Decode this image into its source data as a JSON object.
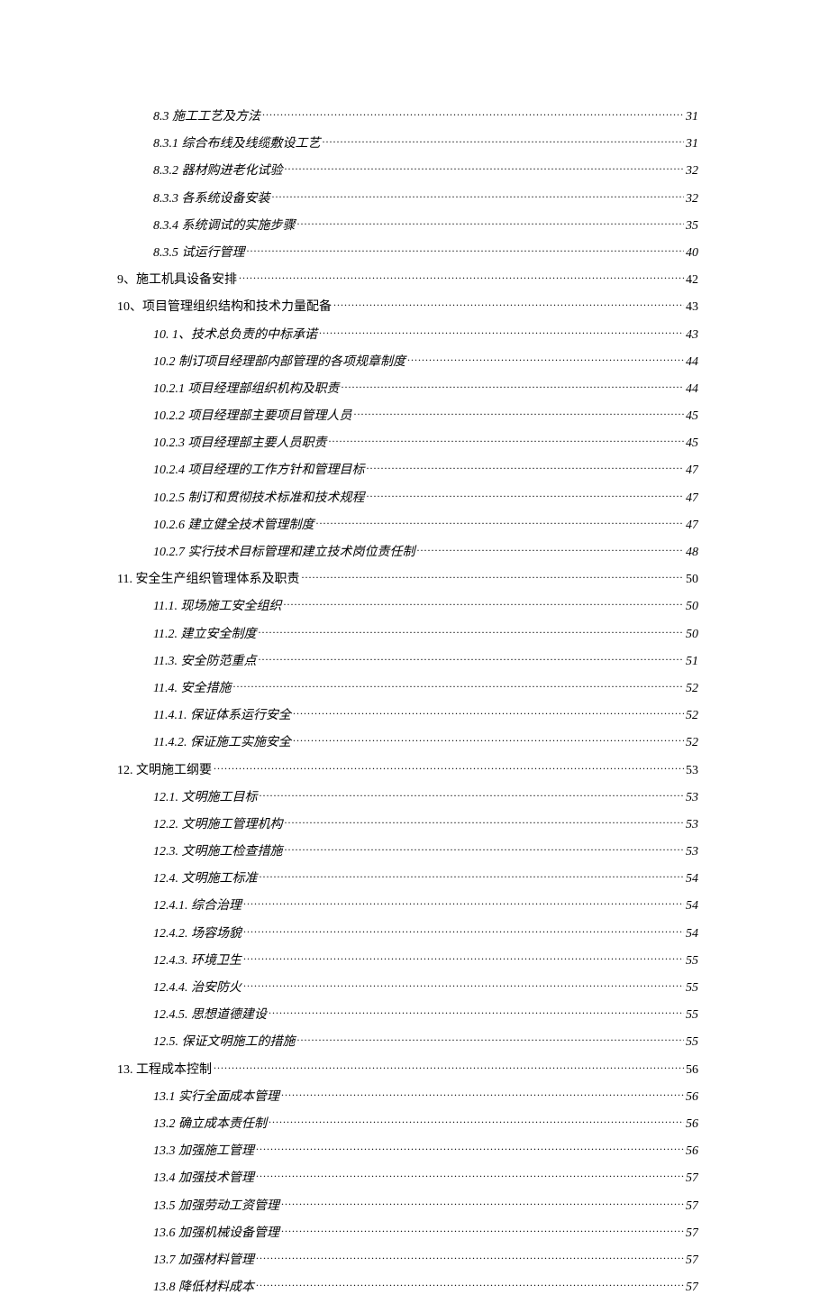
{
  "toc": [
    {
      "level": 2,
      "title": "8.3 施工工艺及方法",
      "page": "31"
    },
    {
      "level": 2,
      "title": "8.3.1 综合布线及线缆敷设工艺",
      "page": "31"
    },
    {
      "level": 2,
      "title": "8.3.2 器材购进老化试验",
      "page": "32"
    },
    {
      "level": 2,
      "title": "8.3.3 各系统设备安装",
      "page": "32"
    },
    {
      "level": 2,
      "title": "8.3.4 系统调试的实施步骤",
      "page": "35"
    },
    {
      "level": 2,
      "title": "8.3.5 试运行管理",
      "page": "40"
    },
    {
      "level": 1,
      "title": "9、施工机具设备安排",
      "page": "42"
    },
    {
      "level": 1,
      "title": "10、项目管理组织结构和技术力量配备",
      "page": "43"
    },
    {
      "level": 2,
      "title": "10. 1、技术总负责的中标承诺",
      "page": "43"
    },
    {
      "level": 2,
      "title": "10.2 制订项目经理部内部管理的各项规章制度",
      "page": "44"
    },
    {
      "level": 2,
      "title": "10.2.1 项目经理部组织机构及职责",
      "page": "44"
    },
    {
      "level": 2,
      "title": "10.2.2 项目经理部主要项目管理人员",
      "page": "45"
    },
    {
      "level": 2,
      "title": "10.2.3 项目经理部主要人员职责",
      "page": "45"
    },
    {
      "level": 2,
      "title": "10.2.4 项目经理的工作方针和管理目标",
      "page": "47"
    },
    {
      "level": 2,
      "title": "10.2.5 制订和贯彻技术标准和技术规程",
      "page": "47"
    },
    {
      "level": 2,
      "title": "10.2.6 建立健全技术管理制度",
      "page": "47"
    },
    {
      "level": 2,
      "title": "10.2.7 实行技术目标管理和建立技术岗位责任制",
      "page": "48"
    },
    {
      "level": 1,
      "title": "11. 安全生产组织管理体系及职责",
      "page": "50"
    },
    {
      "level": 2,
      "title": "11.1. 现场施工安全组织",
      "page": "50"
    },
    {
      "level": 2,
      "title": "11.2. 建立安全制度",
      "page": "50"
    },
    {
      "level": 2,
      "title": "11.3. 安全防范重点",
      "page": "51"
    },
    {
      "level": 2,
      "title": "11.4. 安全措施",
      "page": "52"
    },
    {
      "level": 2,
      "title": "11.4.1. 保证体系运行安全",
      "page": "52"
    },
    {
      "level": 2,
      "title": "11.4.2. 保证施工实施安全",
      "page": "52"
    },
    {
      "level": 1,
      "title": "12. 文明施工纲要",
      "page": "53"
    },
    {
      "level": 2,
      "title": "12.1. 文明施工目标",
      "page": "53"
    },
    {
      "level": 2,
      "title": "12.2. 文明施工管理机构",
      "page": "53"
    },
    {
      "level": 2,
      "title": "12.3. 文明施工检查措施",
      "page": "53"
    },
    {
      "level": 2,
      "title": "12.4. 文明施工标准",
      "page": "54"
    },
    {
      "level": 2,
      "title": "12.4.1. 综合治理",
      "page": "54"
    },
    {
      "level": 2,
      "title": "12.4.2. 场容场貌",
      "page": "54"
    },
    {
      "level": 2,
      "title": "12.4.3. 环境卫生",
      "page": "55"
    },
    {
      "level": 2,
      "title": "12.4.4. 治安防火",
      "page": "55"
    },
    {
      "level": 2,
      "title": "12.4.5. 思想道德建设",
      "page": "55"
    },
    {
      "level": 2,
      "title": "12.5. 保证文明施工的措施",
      "page": "55"
    },
    {
      "level": 1,
      "title": "13. 工程成本控制",
      "page": "56"
    },
    {
      "level": 2,
      "title": "13.1 实行全面成本管理",
      "page": "56"
    },
    {
      "level": 2,
      "title": "13.2 确立成本责任制",
      "page": "56"
    },
    {
      "level": 2,
      "title": "13.3 加强施工管理",
      "page": "56"
    },
    {
      "level": 2,
      "title": "13.4 加强技术管理",
      "page": "57"
    },
    {
      "level": 2,
      "title": "13.5 加强劳动工资管理",
      "page": "57"
    },
    {
      "level": 2,
      "title": "13.6 加强机械设备管理",
      "page": "57"
    },
    {
      "level": 2,
      "title": "13.7 加强材料管理",
      "page": "57"
    },
    {
      "level": 2,
      "title": "13.8 降低材料成本",
      "page": "57"
    }
  ]
}
